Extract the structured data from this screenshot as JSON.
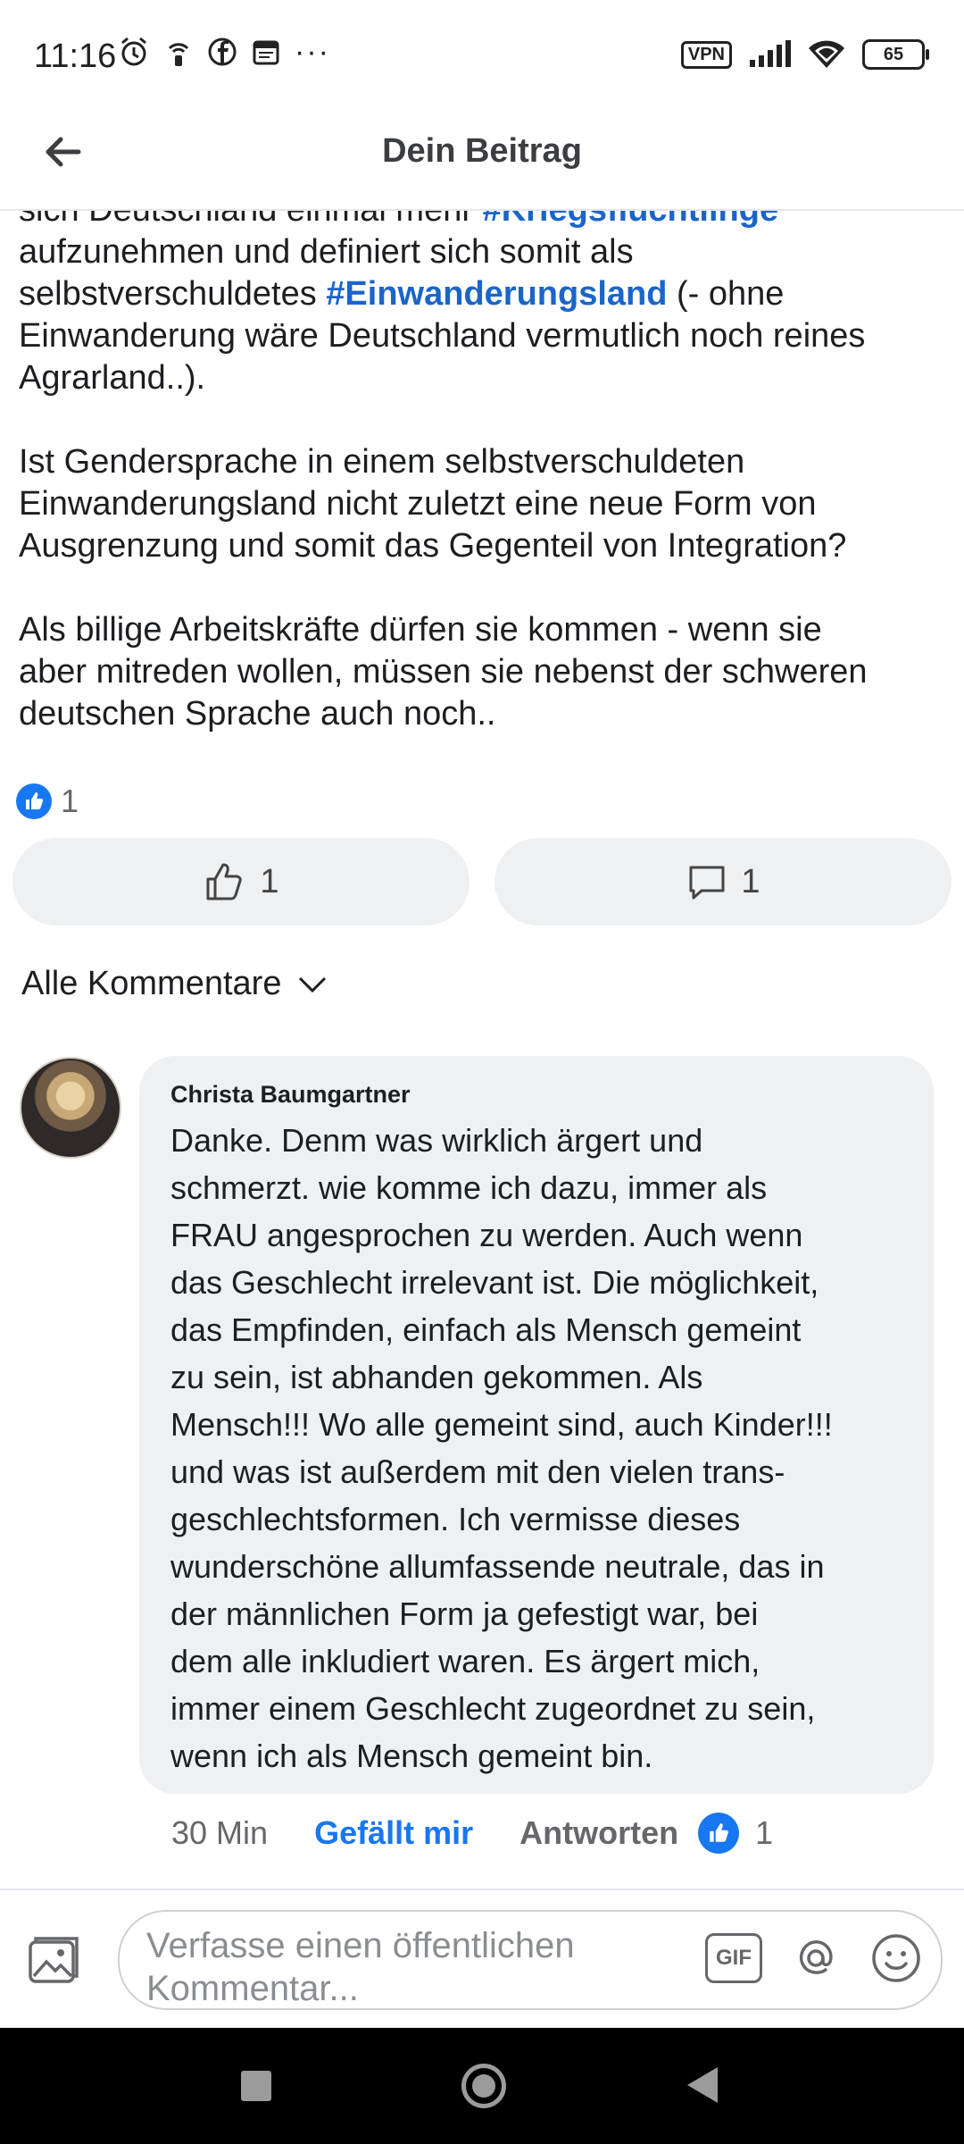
{
  "status_bar": {
    "time": "11:16",
    "vpn_label": "VPN",
    "battery": "65",
    "icons_left": [
      "alarm-icon",
      "hotspot-icon",
      "facebook-icon",
      "calendar-icon",
      "more-dots-icon"
    ],
    "icons_right": [
      "vpn-icon",
      "signal-icon",
      "wifi-icon",
      "battery-icon"
    ]
  },
  "header": {
    "title": "Dein Beitrag",
    "back_icon": "arrow-left-icon"
  },
  "post": {
    "line_partial_prefix": "sich Deutschland einmal mehr ",
    "hashtag_1": "#Kriegsflüchtlinge",
    "line_2": "aufzunehmen und definiert sich somit als",
    "line_3_prefix": "selbstverschuldetes ",
    "hashtag_2": "#Einwanderungsland",
    "line_3_suffix": " (- ohne",
    "line_4": "Einwanderung wäre Deutschland vermutlich noch reines",
    "line_5": "Agrarland..).",
    "paragraph_2_l1": "Ist Gendersprache in einem selbstverschuldeten",
    "paragraph_2_l2": "Einwanderungsland nicht zuletzt eine neue Form von",
    "paragraph_2_l3": "Ausgrenzung und somit das Gegenteil von Integration?",
    "paragraph_3_l1": "Als billige Arbeitskräfte dürfen sie kommen - wenn sie",
    "paragraph_3_l2": "aber mitreden wollen, müssen sie nebenst der schweren",
    "paragraph_3_l3": "deutschen Sprache auch noch.."
  },
  "reactions": {
    "count": "1",
    "icon": "like-reaction-icon"
  },
  "actions": {
    "like_count": "1",
    "comment_count": "1",
    "like_icon": "thumbs-up-icon",
    "comment_icon": "comment-bubble-icon"
  },
  "comments": {
    "sort_label": "Alle Kommentare",
    "items": [
      {
        "author": "Christa Baumgartner",
        "lines": [
          "Danke. Denm was wirklich ärgert und",
          "schmerzt. wie komme ich dazu, immer als",
          "FRAU angesprochen zu werden.  Auch wenn",
          "das Geschlecht irrelevant ist. Die möglichkeit,",
          "das Empfinden, einfach als Mensch gemeint",
          "zu sein, ist abhanden gekommen. Als",
          "Mensch!!! Wo alle gemeint sind, auch Kinder!!!",
          "und was ist außerdem mit den vielen trans-",
          "geschlechtsformen. Ich vermisse dieses",
          "wunderschöne allumfassende neutrale, das in",
          "der männlichen Form ja gefestigt war, bei",
          "dem alle inkludiert waren. Es ärgert mich,",
          "immer einem Geschlecht zugeordnet zu sein,",
          "wenn ich als Mensch gemeint bin."
        ],
        "time": "30 Min",
        "like_label": "Gefällt mir",
        "reply_label": "Antworten",
        "like_count": "1"
      }
    ]
  },
  "composer": {
    "placeholder": "Verfasse einen öffentlichen Kommentar...",
    "gif_label": "GIF",
    "icons": [
      "photo-icon",
      "gif-icon",
      "mention-icon",
      "emoji-icon"
    ]
  },
  "colors": {
    "accent": "#1877f2",
    "hashtag": "#1b65c9",
    "pill_bg": "#eff0f2"
  }
}
